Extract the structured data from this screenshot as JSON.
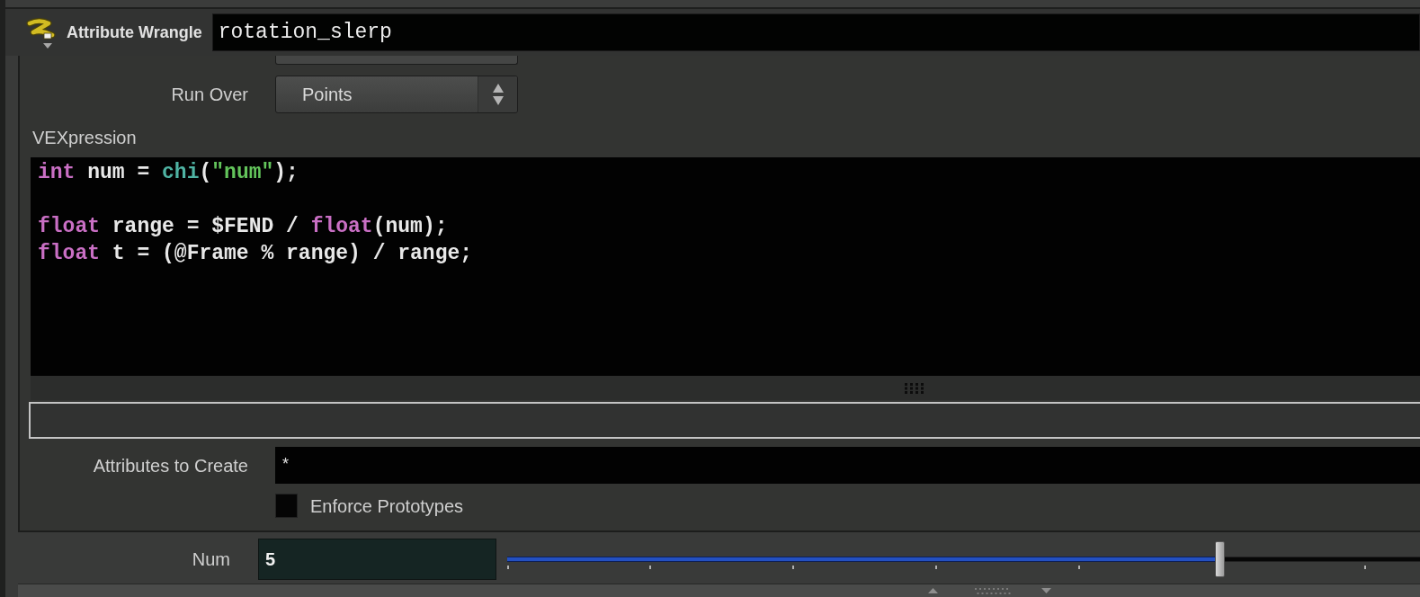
{
  "header": {
    "node_type": "Attribute Wrangle",
    "node_name": "rotation_slerp"
  },
  "parameters": {
    "run_over": {
      "label": "Run Over",
      "value": "Points"
    },
    "vexpression": {
      "label": "VEXpression",
      "lines": [
        {
          "kind": "code",
          "tokens": [
            {
              "kind": "keyword",
              "text": "int"
            },
            {
              "kind": "plain",
              "text": " num = "
            },
            {
              "kind": "function",
              "text": "chi"
            },
            {
              "kind": "plain",
              "text": "("
            },
            {
              "kind": "string",
              "text": "\"num\""
            },
            {
              "kind": "plain",
              "text": ");"
            }
          ]
        },
        {
          "kind": "blank"
        },
        {
          "kind": "code",
          "tokens": [
            {
              "kind": "keyword",
              "text": "float"
            },
            {
              "kind": "plain",
              "text": " range = $FEND / "
            },
            {
              "kind": "keyword",
              "text": "float"
            },
            {
              "kind": "plain",
              "text": "(num);"
            }
          ]
        },
        {
          "kind": "code",
          "tokens": [
            {
              "kind": "keyword",
              "text": "float"
            },
            {
              "kind": "plain",
              "text": " t = (@Frame % range) / range;"
            }
          ]
        }
      ]
    },
    "attributes_to_create": {
      "label": "Attributes to Create",
      "value": "*"
    },
    "enforce_prototypes": {
      "label": "Enforce Prototypes",
      "checked": false
    }
  },
  "num": {
    "label": "Num",
    "value": "5",
    "level": 0.78
  }
}
